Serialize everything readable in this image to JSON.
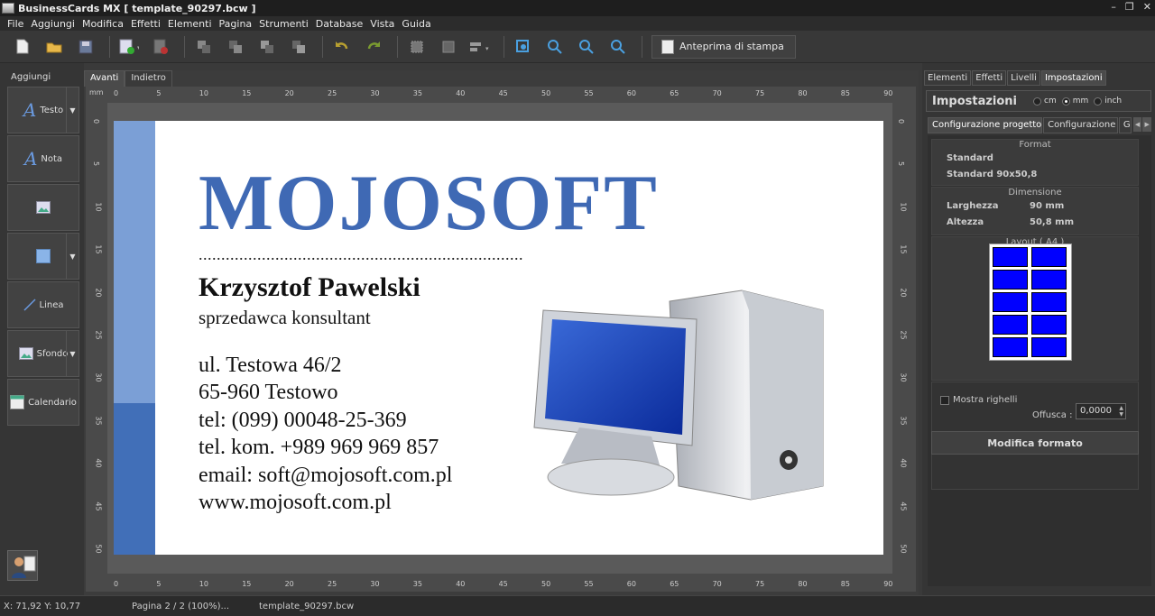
{
  "window": {
    "title": "BusinessCards MX [ template_90297.bcw ]"
  },
  "menu": [
    "File",
    "Aggiungi",
    "Modifica",
    "Effetti",
    "Elementi",
    "Pagina",
    "Strumenti",
    "Database",
    "Vista",
    "Guida"
  ],
  "toolbar": {
    "print_preview": "Anteprima di stampa"
  },
  "left_panel": {
    "header": "Aggiungi",
    "buttons": {
      "text": "Testo",
      "note": "Nota",
      "line": "Linea",
      "background": "Sfondo",
      "calendar": "Calendario"
    }
  },
  "doc_tabs": [
    "Avanti",
    "Indietro"
  ],
  "ruler": {
    "unit": "mm",
    "h_labels": [
      "0",
      "5",
      "10",
      "15",
      "20",
      "25",
      "30",
      "35",
      "40",
      "45",
      "50",
      "55",
      "60",
      "65",
      "70",
      "75",
      "80",
      "85",
      "90"
    ],
    "v_labels": [
      "0",
      "5",
      "10",
      "15",
      "20",
      "25",
      "30",
      "35",
      "40",
      "45",
      "50"
    ]
  },
  "card": {
    "logo": "MOJOSOFT",
    "separator": "........................................................................",
    "name": "Krzysztof Pawelski",
    "role": "sprzedawca konsultant",
    "lines": [
      "ul. Testowa 46/2",
      "65-960 Testowo",
      "tel: (099) 00048-25-369",
      "tel. kom. +989 969 969 857",
      "email: soft@mojosoft.com.pl",
      "www.mojosoft.com.pl"
    ],
    "stripe_top_color": "#7b9fd6",
    "stripe_bottom_color": "#416fb8",
    "logo_color": "#3f69b4"
  },
  "right_panel": {
    "tabs": [
      "Elementi",
      "Effetti",
      "Livelli",
      "Impostazioni"
    ],
    "title": "Impostazioni",
    "units": [
      "cm",
      "mm",
      "inch"
    ],
    "subtabs": [
      "Configurazione progetto",
      "Configurazione",
      "G"
    ],
    "format_title": "Format",
    "format_name": "Standard",
    "format_size": "Standard 90x50,8",
    "dim_title": "Dimensione",
    "width_label": "Larghezza",
    "width_value": "90 mm",
    "height_label": "Altezza",
    "height_value": "50,8 mm",
    "layout_title": "Layout ( A4 )",
    "show_rulers": "Mostra righelli",
    "offset_label": "Offusca :",
    "offset_value": "0,0000",
    "modify_button": "Modifica formato"
  },
  "status": {
    "coords": "X: 71,92 Y: 10,77",
    "page": "Pagina 2 / 2 (100%)...",
    "file": "template_90297.bcw"
  }
}
